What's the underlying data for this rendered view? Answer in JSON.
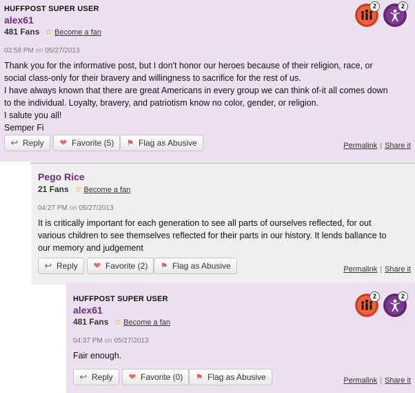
{
  "comments": [
    {
      "tag": "HUFFPOST SUPER USER",
      "username": "alex61",
      "fans": "481 Fans",
      "become_fan": "Become a fan",
      "time": "03:58 PM",
      "on": "on",
      "date": "05/27/2013",
      "lines": [
        "Thank you for the informative post, but I don't honor our heroes because of their religion, race, or",
        "social class-only for their bravery and willingness to sacrifice for the rest of us.",
        "I have always known that there are great Americans in every group we can think of-it all comes down",
        "to the individual. Loyalty, bravery, and patriotism know no color, gender, or religion.",
        "I salute you all!",
        "Semper Fi"
      ],
      "reply": "Reply",
      "favorite": "Favorite (5)",
      "flag": "Flag as Abusive",
      "permalink": "Permalink",
      "sep": "|",
      "share": "Share it",
      "badge1_count": "2",
      "badge2_count": "2"
    },
    {
      "username": "Pego Rice",
      "fans": "21 Fans",
      "become_fan": "Become a fan",
      "time": "04:27 PM",
      "on": "on",
      "date": "05/27/2013",
      "lines": [
        "It is critically important for each generation to see all parts of ourselves reflected, for out",
        "various children to see themselves reflected for their parts in our history. It lends ballance to",
        "our memory and judgement"
      ],
      "reply": "Reply",
      "favorite": "Favorite (2)",
      "flag": "Flag as Abusive",
      "permalink": "Permalink",
      "sep": "|",
      "share": "Share it"
    },
    {
      "tag": "HUFFPOST SUPER USER",
      "username": "alex61",
      "fans": "481 Fans",
      "become_fan": "Become a fan",
      "time": "04:37 PM",
      "on": "on",
      "date": "05/27/2013",
      "lines": [
        "Fair enough."
      ],
      "reply": "Reply",
      "favorite": "Favorite (0)",
      "flag": "Flag as Abusive",
      "permalink": "Permalink",
      "sep": "|",
      "share": "Share it",
      "badge1_count": "2",
      "badge2_count": "2"
    }
  ],
  "icons": {
    "reply": "reply-arrow-icon",
    "favorite": "heart-icon",
    "flag": "flag-icon",
    "badge1": "networker-badge-icon",
    "badge2": "superuser-badge-icon"
  },
  "colors": {
    "super_user_bg": "#ede0f0",
    "regular_bg": "#efefef",
    "username": "#6b2d7a",
    "badge_orange": "#f3603a",
    "badge_purple": "#7b3a8f"
  }
}
